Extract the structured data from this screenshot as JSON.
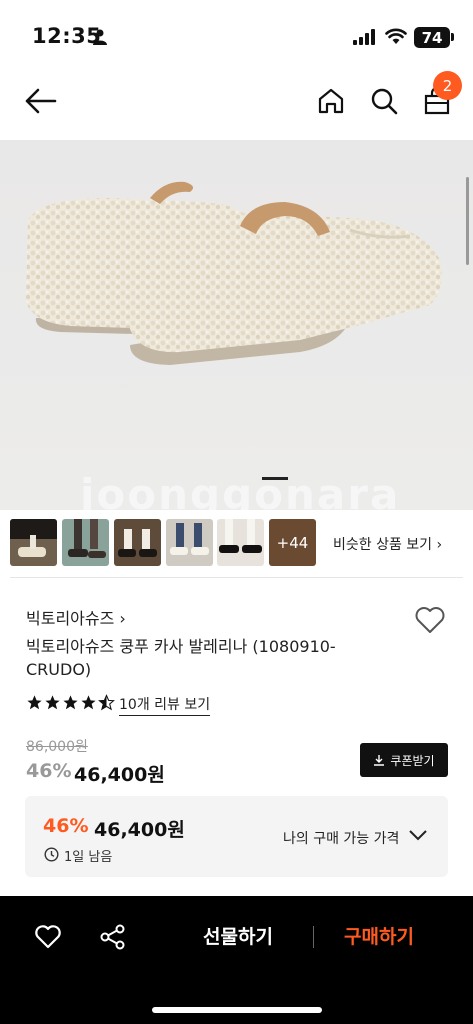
{
  "status_bar": {
    "time": "12:35",
    "battery": "74"
  },
  "header": {
    "cart_badge": "2"
  },
  "thumbnails": {
    "more_label": "+44",
    "similar_label": "비슷한 상품 보기"
  },
  "product": {
    "brand": "빅토리아슈즈",
    "title": "빅토리아슈즈 쿵푸 카사 발레리나 (1080910-CRUDO)",
    "rating": 4.5,
    "review_link": "10개 리뷰 보기",
    "original_price": "86,000원",
    "discount_rate": "46%",
    "sale_price": "46,400원",
    "coupon_label": "쿠폰받기"
  },
  "best_price": {
    "discount_rate": "46%",
    "price": "46,400원",
    "remaining": "1일 남음",
    "label": "나의 구매 가능 가격"
  },
  "action_bar": {
    "gift_label": "선물하기",
    "buy_label": "구매하기"
  },
  "colors": {
    "accent": "#ff5a1f",
    "dark": "#111111"
  },
  "icons": [
    "back-arrow-icon",
    "home-icon",
    "search-icon",
    "cart-icon",
    "heart-icon",
    "star-icon",
    "download-icon",
    "clock-icon",
    "chevron-down-icon",
    "share-icon"
  ]
}
